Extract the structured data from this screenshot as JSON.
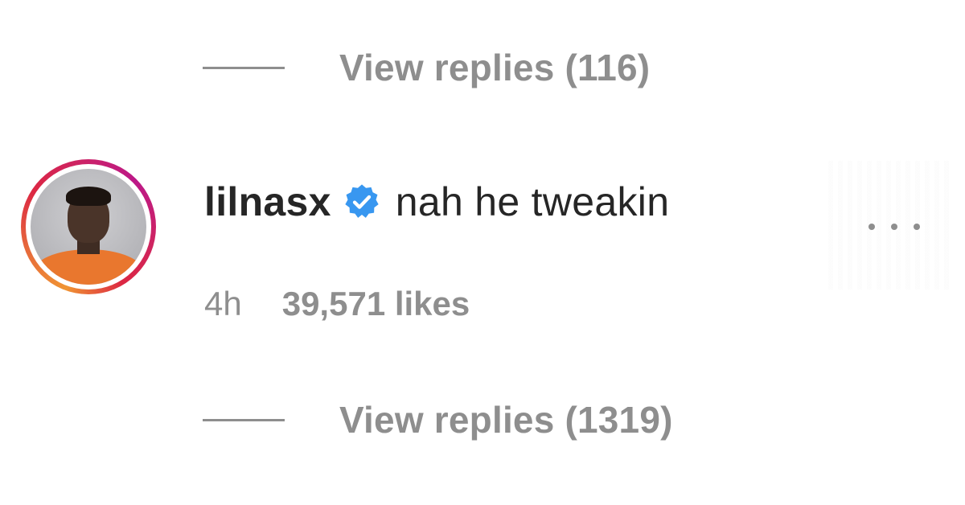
{
  "replies_top": {
    "label": "View replies (116)"
  },
  "comment": {
    "username": "lilnasx",
    "verified_icon": "verified-badge-icon",
    "text": "nah he tweakin",
    "timestamp": "4h",
    "likes": "39,571 likes",
    "more_icon": "more-options-icon",
    "colors": {
      "verified": "#3897f0",
      "primary_text": "#262626",
      "secondary_text": "#8e8e8e"
    }
  },
  "replies_bottom": {
    "label": "View replies (1319)"
  }
}
